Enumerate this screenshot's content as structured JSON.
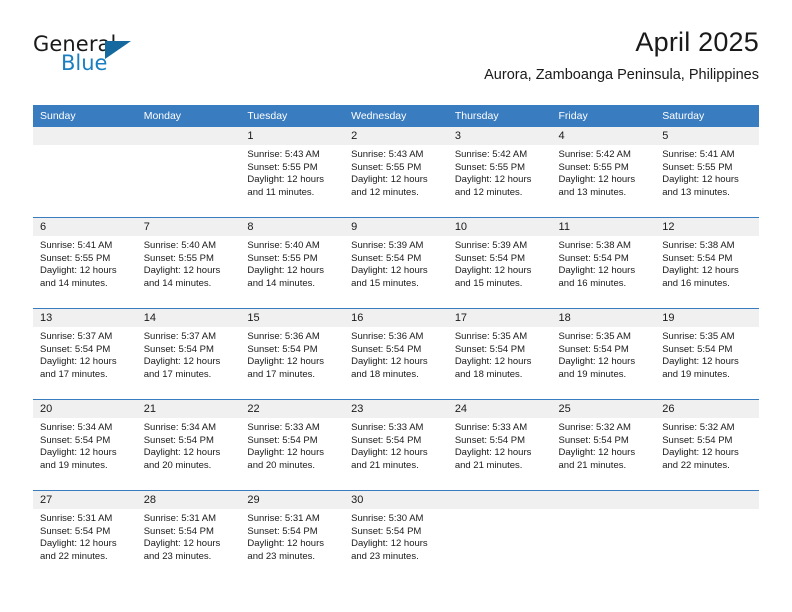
{
  "logo": {
    "word_top": "General",
    "word_bottom": "Blue",
    "triangle_color": "#15699f",
    "blue_color": "#1a7fc1"
  },
  "header": {
    "title": "April 2025",
    "subtitle": "Aurora, Zamboanga Peninsula, Philippines"
  },
  "colors": {
    "header_band": "#3a7cc0",
    "daynum_band": "#f0f0f0",
    "text": "#1a1a1a"
  },
  "weekday_headers": [
    "Sunday",
    "Monday",
    "Tuesday",
    "Wednesday",
    "Thursday",
    "Friday",
    "Saturday"
  ],
  "weeks": [
    [
      {
        "day": "",
        "sunrise": "",
        "sunset": "",
        "daylight_1": "",
        "daylight_2": ""
      },
      {
        "day": "",
        "sunrise": "",
        "sunset": "",
        "daylight_1": "",
        "daylight_2": ""
      },
      {
        "day": "1",
        "sunrise": "Sunrise: 5:43 AM",
        "sunset": "Sunset: 5:55 PM",
        "daylight_1": "Daylight: 12 hours",
        "daylight_2": "and 11 minutes."
      },
      {
        "day": "2",
        "sunrise": "Sunrise: 5:43 AM",
        "sunset": "Sunset: 5:55 PM",
        "daylight_1": "Daylight: 12 hours",
        "daylight_2": "and 12 minutes."
      },
      {
        "day": "3",
        "sunrise": "Sunrise: 5:42 AM",
        "sunset": "Sunset: 5:55 PM",
        "daylight_1": "Daylight: 12 hours",
        "daylight_2": "and 12 minutes."
      },
      {
        "day": "4",
        "sunrise": "Sunrise: 5:42 AM",
        "sunset": "Sunset: 5:55 PM",
        "daylight_1": "Daylight: 12 hours",
        "daylight_2": "and 13 minutes."
      },
      {
        "day": "5",
        "sunrise": "Sunrise: 5:41 AM",
        "sunset": "Sunset: 5:55 PM",
        "daylight_1": "Daylight: 12 hours",
        "daylight_2": "and 13 minutes."
      }
    ],
    [
      {
        "day": "6",
        "sunrise": "Sunrise: 5:41 AM",
        "sunset": "Sunset: 5:55 PM",
        "daylight_1": "Daylight: 12 hours",
        "daylight_2": "and 14 minutes."
      },
      {
        "day": "7",
        "sunrise": "Sunrise: 5:40 AM",
        "sunset": "Sunset: 5:55 PM",
        "daylight_1": "Daylight: 12 hours",
        "daylight_2": "and 14 minutes."
      },
      {
        "day": "8",
        "sunrise": "Sunrise: 5:40 AM",
        "sunset": "Sunset: 5:55 PM",
        "daylight_1": "Daylight: 12 hours",
        "daylight_2": "and 14 minutes."
      },
      {
        "day": "9",
        "sunrise": "Sunrise: 5:39 AM",
        "sunset": "Sunset: 5:54 PM",
        "daylight_1": "Daylight: 12 hours",
        "daylight_2": "and 15 minutes."
      },
      {
        "day": "10",
        "sunrise": "Sunrise: 5:39 AM",
        "sunset": "Sunset: 5:54 PM",
        "daylight_1": "Daylight: 12 hours",
        "daylight_2": "and 15 minutes."
      },
      {
        "day": "11",
        "sunrise": "Sunrise: 5:38 AM",
        "sunset": "Sunset: 5:54 PM",
        "daylight_1": "Daylight: 12 hours",
        "daylight_2": "and 16 minutes."
      },
      {
        "day": "12",
        "sunrise": "Sunrise: 5:38 AM",
        "sunset": "Sunset: 5:54 PM",
        "daylight_1": "Daylight: 12 hours",
        "daylight_2": "and 16 minutes."
      }
    ],
    [
      {
        "day": "13",
        "sunrise": "Sunrise: 5:37 AM",
        "sunset": "Sunset: 5:54 PM",
        "daylight_1": "Daylight: 12 hours",
        "daylight_2": "and 17 minutes."
      },
      {
        "day": "14",
        "sunrise": "Sunrise: 5:37 AM",
        "sunset": "Sunset: 5:54 PM",
        "daylight_1": "Daylight: 12 hours",
        "daylight_2": "and 17 minutes."
      },
      {
        "day": "15",
        "sunrise": "Sunrise: 5:36 AM",
        "sunset": "Sunset: 5:54 PM",
        "daylight_1": "Daylight: 12 hours",
        "daylight_2": "and 17 minutes."
      },
      {
        "day": "16",
        "sunrise": "Sunrise: 5:36 AM",
        "sunset": "Sunset: 5:54 PM",
        "daylight_1": "Daylight: 12 hours",
        "daylight_2": "and 18 minutes."
      },
      {
        "day": "17",
        "sunrise": "Sunrise: 5:35 AM",
        "sunset": "Sunset: 5:54 PM",
        "daylight_1": "Daylight: 12 hours",
        "daylight_2": "and 18 minutes."
      },
      {
        "day": "18",
        "sunrise": "Sunrise: 5:35 AM",
        "sunset": "Sunset: 5:54 PM",
        "daylight_1": "Daylight: 12 hours",
        "daylight_2": "and 19 minutes."
      },
      {
        "day": "19",
        "sunrise": "Sunrise: 5:35 AM",
        "sunset": "Sunset: 5:54 PM",
        "daylight_1": "Daylight: 12 hours",
        "daylight_2": "and 19 minutes."
      }
    ],
    [
      {
        "day": "20",
        "sunrise": "Sunrise: 5:34 AM",
        "sunset": "Sunset: 5:54 PM",
        "daylight_1": "Daylight: 12 hours",
        "daylight_2": "and 19 minutes."
      },
      {
        "day": "21",
        "sunrise": "Sunrise: 5:34 AM",
        "sunset": "Sunset: 5:54 PM",
        "daylight_1": "Daylight: 12 hours",
        "daylight_2": "and 20 minutes."
      },
      {
        "day": "22",
        "sunrise": "Sunrise: 5:33 AM",
        "sunset": "Sunset: 5:54 PM",
        "daylight_1": "Daylight: 12 hours",
        "daylight_2": "and 20 minutes."
      },
      {
        "day": "23",
        "sunrise": "Sunrise: 5:33 AM",
        "sunset": "Sunset: 5:54 PM",
        "daylight_1": "Daylight: 12 hours",
        "daylight_2": "and 21 minutes."
      },
      {
        "day": "24",
        "sunrise": "Sunrise: 5:33 AM",
        "sunset": "Sunset: 5:54 PM",
        "daylight_1": "Daylight: 12 hours",
        "daylight_2": "and 21 minutes."
      },
      {
        "day": "25",
        "sunrise": "Sunrise: 5:32 AM",
        "sunset": "Sunset: 5:54 PM",
        "daylight_1": "Daylight: 12 hours",
        "daylight_2": "and 21 minutes."
      },
      {
        "day": "26",
        "sunrise": "Sunrise: 5:32 AM",
        "sunset": "Sunset: 5:54 PM",
        "daylight_1": "Daylight: 12 hours",
        "daylight_2": "and 22 minutes."
      }
    ],
    [
      {
        "day": "27",
        "sunrise": "Sunrise: 5:31 AM",
        "sunset": "Sunset: 5:54 PM",
        "daylight_1": "Daylight: 12 hours",
        "daylight_2": "and 22 minutes."
      },
      {
        "day": "28",
        "sunrise": "Sunrise: 5:31 AM",
        "sunset": "Sunset: 5:54 PM",
        "daylight_1": "Daylight: 12 hours",
        "daylight_2": "and 23 minutes."
      },
      {
        "day": "29",
        "sunrise": "Sunrise: 5:31 AM",
        "sunset": "Sunset: 5:54 PM",
        "daylight_1": "Daylight: 12 hours",
        "daylight_2": "and 23 minutes."
      },
      {
        "day": "30",
        "sunrise": "Sunrise: 5:30 AM",
        "sunset": "Sunset: 5:54 PM",
        "daylight_1": "Daylight: 12 hours",
        "daylight_2": "and 23 minutes."
      },
      {
        "day": "",
        "sunrise": "",
        "sunset": "",
        "daylight_1": "",
        "daylight_2": ""
      },
      {
        "day": "",
        "sunrise": "",
        "sunset": "",
        "daylight_1": "",
        "daylight_2": ""
      },
      {
        "day": "",
        "sunrise": "",
        "sunset": "",
        "daylight_1": "",
        "daylight_2": ""
      }
    ]
  ]
}
